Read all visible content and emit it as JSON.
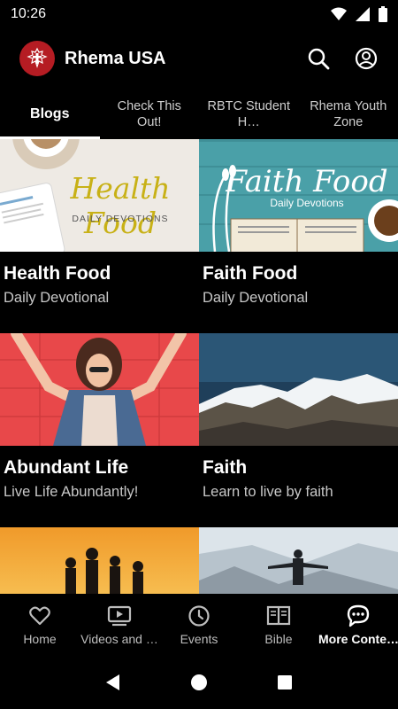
{
  "status_bar": {
    "time": "10:26"
  },
  "app": {
    "title": "Rhema USA"
  },
  "tabs": [
    {
      "label": "Blogs",
      "active": true
    },
    {
      "label": "Check This Out!",
      "active": false
    },
    {
      "label": "RBTC Student H…",
      "active": false
    },
    {
      "label": "Rhema Youth Zone",
      "active": false
    }
  ],
  "cards": [
    {
      "title": "Health Food",
      "subtitle": "Daily Devotional",
      "image_text": "Health Food",
      "image_caption": "DAILY DEVOTIONS"
    },
    {
      "title": "Faith Food",
      "subtitle": "Daily Devotional",
      "image_text": "Faith Food",
      "image_caption": "Daily Devotions"
    },
    {
      "title": "Abundant Life",
      "subtitle": "Live Life Abundantly!"
    },
    {
      "title": "Faith",
      "subtitle": "Learn to live by faith"
    },
    {
      "title": "",
      "subtitle": ""
    },
    {
      "title": "",
      "subtitle": ""
    }
  ],
  "bottom_nav": [
    {
      "label": "Home",
      "icon": "heart-icon",
      "active": false
    },
    {
      "label": "Videos and …",
      "icon": "video-icon",
      "active": false
    },
    {
      "label": "Events",
      "icon": "clock-icon",
      "active": false
    },
    {
      "label": "Bible",
      "icon": "book-icon",
      "active": false
    },
    {
      "label": "More Conte…",
      "icon": "chat-icon",
      "active": true
    }
  ],
  "colors": {
    "brand": "#b51c23",
    "background": "#000000"
  }
}
